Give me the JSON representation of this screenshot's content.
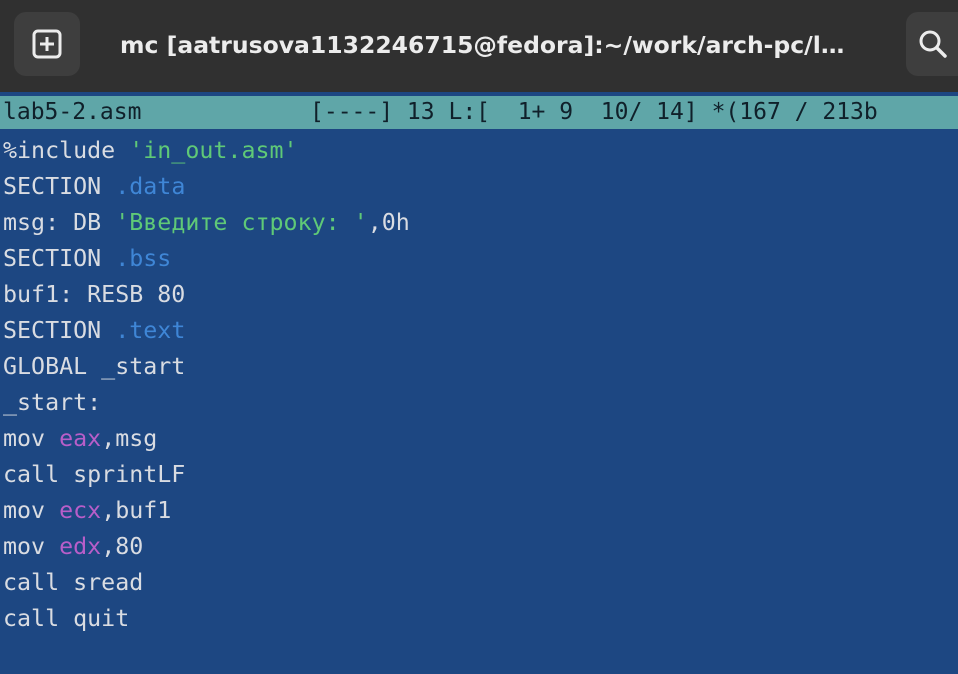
{
  "window": {
    "title": "mc [aatrusova1132246715@fedora]:~/work/arch-pc/l…",
    "new_tab_icon": "plus-square-icon",
    "search_icon": "search-icon"
  },
  "status": {
    "filename": "lab5-2.asm",
    "info": "[----] 13 L:[  1+ 9  10/ 14] *(167 / 213b"
  },
  "code": {
    "l1": {
      "kw": "%include ",
      "str": "'in_out.asm'"
    },
    "l2": {
      "kw": "SECTION ",
      "sec": ".data"
    },
    "l3": {
      "a": "msg: DB ",
      "str": "'Введите строку: '",
      "b": ",0h"
    },
    "l4": {
      "kw": "SECTION ",
      "sec": ".bss"
    },
    "l5": {
      "text": "buf1: RESB 80"
    },
    "l6": {
      "kw": "SECTION ",
      "sec": ".text"
    },
    "l7": {
      "text": "GLOBAL _start"
    },
    "l8": {
      "text": "_start:"
    },
    "l9": {
      "kw": "mov ",
      "reg": "eax",
      "rest": ",msg"
    },
    "l10": {
      "text": "call sprintLF"
    },
    "l11": {
      "kw": "mov ",
      "reg": "ecx",
      "rest": ",buf1"
    },
    "l12": {
      "kw": "mov ",
      "reg": "edx",
      "rest": ",80"
    },
    "l13": {
      "text": "call sread"
    },
    "l14": {
      "text": "call quit"
    }
  },
  "colors": {
    "editor_bg": "#1d4782",
    "status_bg": "#5fa6a8",
    "string": "#5fc977",
    "section": "#3f86d6",
    "register": "#b85ec9"
  }
}
